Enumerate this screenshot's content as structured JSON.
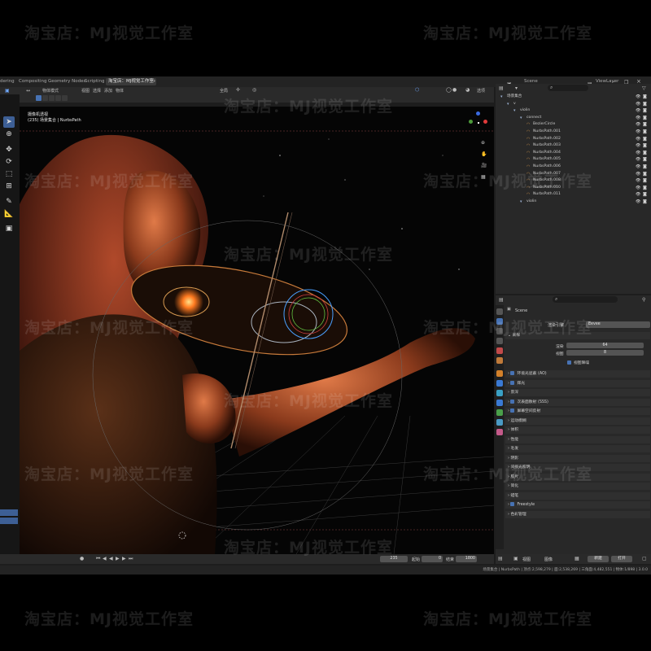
{
  "watermark": "淘宝店：MJ视觉工作室",
  "topbar": {
    "tabs": [
      "dering",
      "Compositing",
      "Geometry Nodes",
      "Scripting",
      "淘宝店：MJ视觉工作室"
    ],
    "add_tab": "+",
    "scene_label": "Scene",
    "view_layer_label": "ViewLayer"
  },
  "viewport_header": {
    "mode": "物体模式",
    "menus": [
      "视图",
      "选择",
      "添加",
      "物体"
    ],
    "pivot": "全局",
    "options": "选项"
  },
  "viewport": {
    "camera_title": "摄像机透视",
    "camera_sub": "(235) 场景集合 | NurbsPath",
    "gizmo_axes": [
      "X",
      "Y",
      "Z"
    ]
  },
  "outliner": {
    "search_placeholder": "",
    "rows": [
      {
        "label": "场景集合",
        "indent": 0
      },
      {
        "label": "v",
        "indent": 1
      },
      {
        "label": "violin",
        "indent": 2
      },
      {
        "label": "connect",
        "indent": 3
      },
      {
        "label": "BezierCircle",
        "indent": 4
      },
      {
        "label": "NurbsPath.001",
        "indent": 4
      },
      {
        "label": "NurbsPath.002",
        "indent": 4
      },
      {
        "label": "NurbsPath.003",
        "indent": 4
      },
      {
        "label": "NurbsPath.004",
        "indent": 4
      },
      {
        "label": "NurbsPath.005",
        "indent": 4
      },
      {
        "label": "NurbsPath.006",
        "indent": 4
      },
      {
        "label": "NurbsPath.007",
        "indent": 4
      },
      {
        "label": "NurbsPath.008",
        "indent": 4
      },
      {
        "label": "NurbsPath.010",
        "indent": 4
      },
      {
        "label": "NurbsPath.011",
        "indent": 4
      },
      {
        "label": "violin",
        "indent": 3
      }
    ]
  },
  "properties": {
    "scene": "Scene",
    "render_engine_label": "渲染引擎",
    "render_engine_value": "Eevee",
    "sampling_label": "采样",
    "render_label": "渲染",
    "render_value": "64",
    "viewport_label": "视图",
    "viewport_value": "8",
    "denoise_label": "视图降噪",
    "sections": [
      "环境光遮蔽 (AO)",
      "辉光",
      "景深",
      "次表面散射 (SSS)",
      "屏幕空间反射",
      "运动模糊",
      "体积",
      "性能",
      "毛发",
      "阴影",
      "间接光照明",
      "胶片",
      "简化",
      "蜡笔",
      "Freestyle",
      "色彩管理"
    ],
    "checked_sections": [
      0,
      1,
      3,
      4,
      14
    ]
  },
  "timeline": {
    "frame": "235",
    "start_label": "起始",
    "start_value": "0",
    "end_label": "结束",
    "end_value": "1800"
  },
  "image_editor_header": {
    "menus": [
      "视图",
      "图像"
    ],
    "new_label": "新建",
    "open_label": "打开"
  },
  "statusbar": {
    "text": "场景集合 | NurbsPath | 顶点:2,598,279 | 面:2,538,269 | 三角面:4,482,551 | 物体:1/898 | 3.0.0"
  },
  "colors": {
    "accent": "#4772b3",
    "bg": "#1d1d1d",
    "panel": "#282828"
  }
}
